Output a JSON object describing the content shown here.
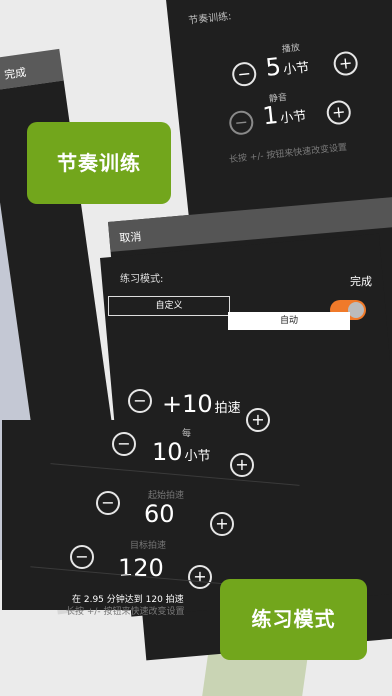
{
  "colors": {
    "accent_green": "#72a61c",
    "toggle_orange": "#f07a2a",
    "panel": "#1f1f1f"
  },
  "left_card": {
    "done_label": "完成"
  },
  "badge_top": "节奏训练",
  "badge_bottom": "练习模式",
  "rhythm": {
    "title": "节奏训练:",
    "play_label": "播放",
    "play_value": "5",
    "play_unit": "小节",
    "mute_label": "静音",
    "mute_value": "1",
    "mute_unit": "小节",
    "hint": "长按 +/- 按钮来快速改变设置"
  },
  "practice": {
    "cancel_label": "取消",
    "done_label": "完成",
    "mode_label": "练习模式:",
    "segments": [
      "自定义",
      "自动"
    ],
    "selected_segment": "自动",
    "toggle_on": true,
    "increment_value": "+10",
    "increment_unit": "拍速",
    "every_label": "每",
    "every_value": "10",
    "every_unit": "小节",
    "start_label": "起始拍速",
    "start_value": "60",
    "target_label": "目标拍速",
    "target_value": "120",
    "summary": "在 2.95 分钟达到 120 拍速",
    "hint": "长按 +/- 按钮来快速改变设置"
  },
  "icons": {
    "minus": "−",
    "plus": "+"
  }
}
